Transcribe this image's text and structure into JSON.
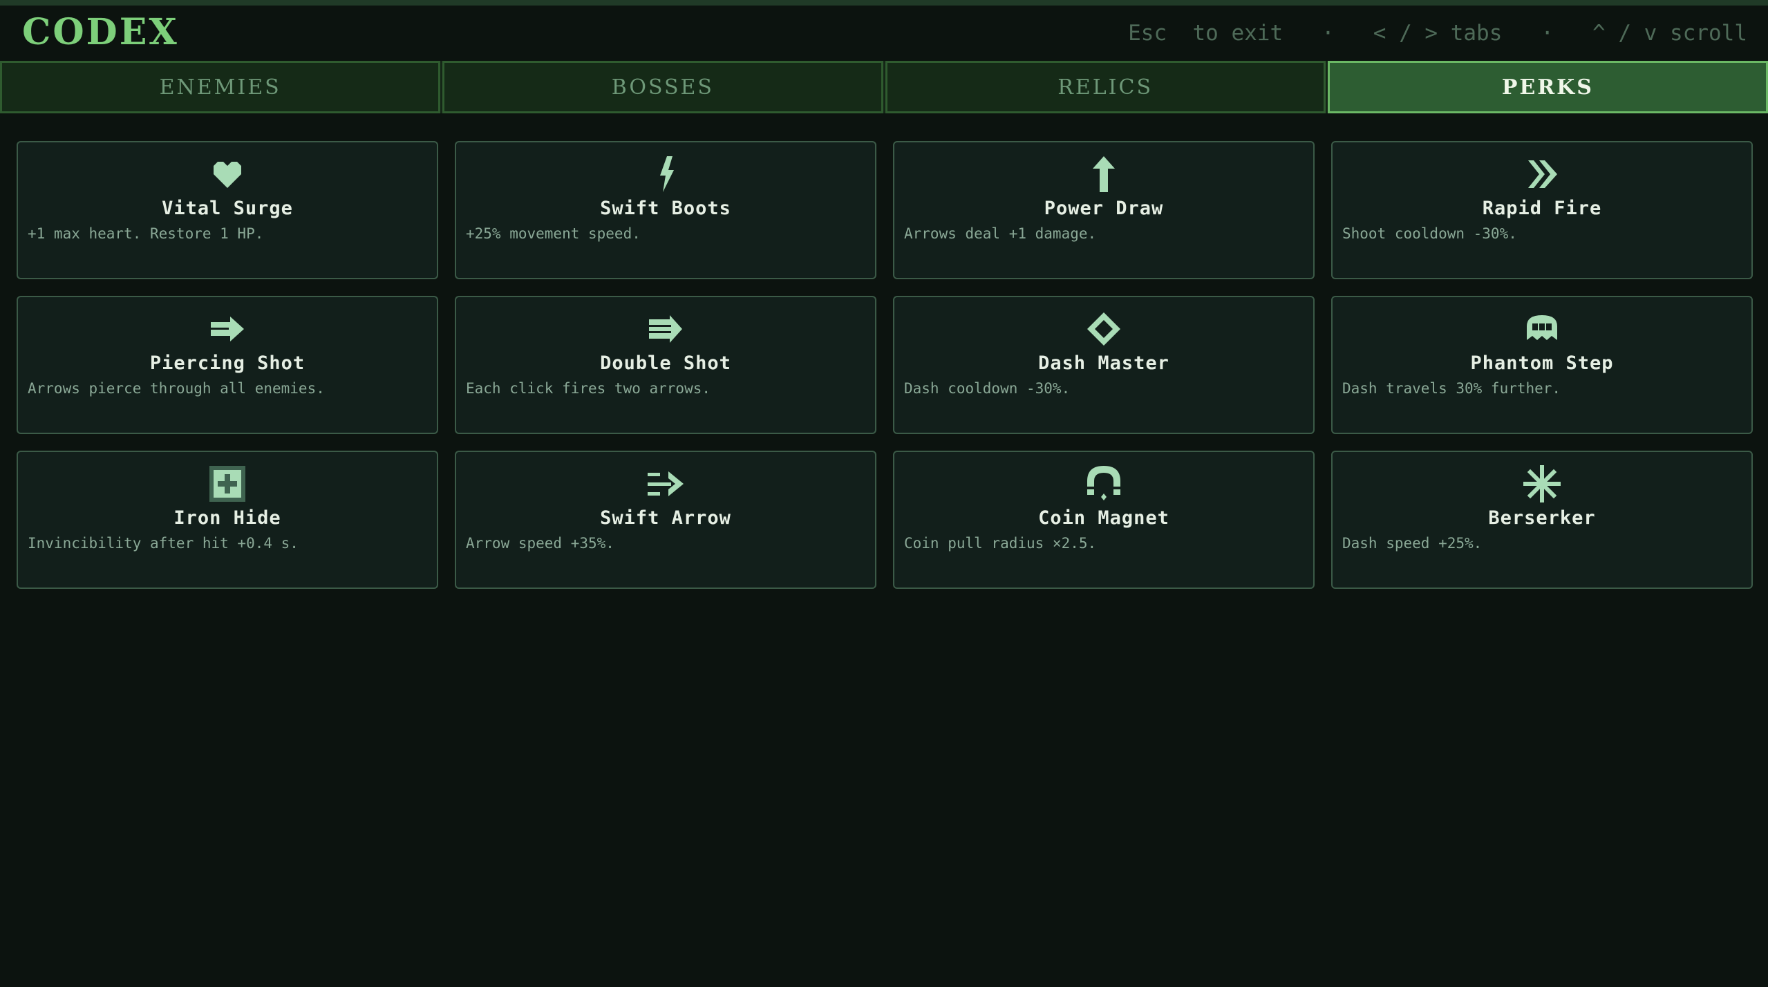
{
  "header": {
    "title": "CODEX",
    "hints": "Esc  to exit   ·   < / > tabs   ·   ^ / v scroll"
  },
  "tabs": [
    {
      "label": "ENEMIES",
      "active": false
    },
    {
      "label": "BOSSES",
      "active": false
    },
    {
      "label": "RELICS",
      "active": false
    },
    {
      "label": "PERKS",
      "active": true
    }
  ],
  "perks": [
    {
      "name": "Vital Surge",
      "desc": "+1 max heart. Restore 1 HP.",
      "icon": "heart-icon"
    },
    {
      "name": "Swift Boots",
      "desc": "+25% movement speed.",
      "icon": "lightning-icon"
    },
    {
      "name": "Power Draw",
      "desc": "Arrows deal +1 damage.",
      "icon": "arrow-up-icon"
    },
    {
      "name": "Rapid Fire",
      "desc": "Shoot cooldown -30%.",
      "icon": "double-chevron-icon"
    },
    {
      "name": "Piercing Shot",
      "desc": "Arrows pierce through all enemies.",
      "icon": "piercing-arrow-icon"
    },
    {
      "name": "Double Shot",
      "desc": "Each click fires two arrows.",
      "icon": "double-arrow-icon"
    },
    {
      "name": "Dash Master",
      "desc": "Dash cooldown -30%.",
      "icon": "diamond-icon"
    },
    {
      "name": "Phantom Step",
      "desc": "Dash travels 30% further.",
      "icon": "ghost-icon"
    },
    {
      "name": "Iron Hide",
      "desc": "Invincibility after hit +0.4 s.",
      "icon": "shield-plus-icon"
    },
    {
      "name": "Swift Arrow",
      "desc": "Arrow speed +35%.",
      "icon": "speed-arrow-icon"
    },
    {
      "name": "Coin Magnet",
      "desc": "Coin pull radius ×2.5.",
      "icon": "magnet-icon"
    },
    {
      "name": "Berserker",
      "desc": "Dash speed +25%.",
      "icon": "starburst-icon"
    }
  ],
  "colors": {
    "background": "#0c130f",
    "accent": "#7dcf7a",
    "icon": "#a9dcb6",
    "card": "#121f1b",
    "active_tab": "#2d5d32"
  }
}
